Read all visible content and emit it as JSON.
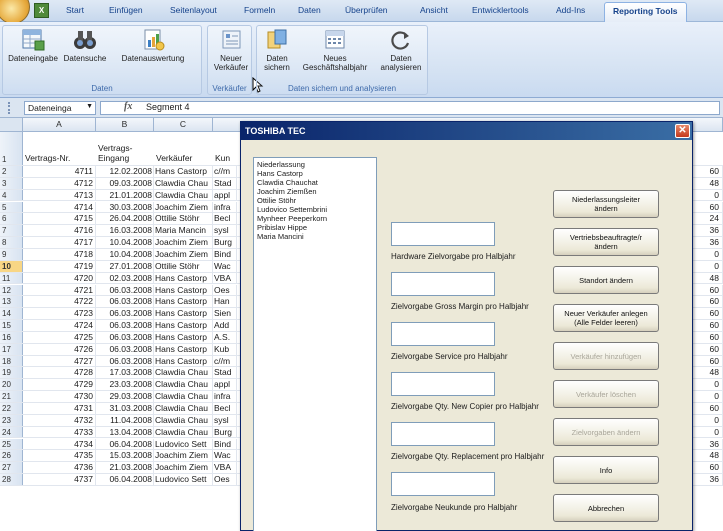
{
  "ribbon": {
    "tabs": [
      "Start",
      "Einfügen",
      "Seitenlayout",
      "Formeln",
      "Daten",
      "Überprüfen",
      "Ansicht",
      "Entwicklertools",
      "Add-Ins",
      "Reporting Tools"
    ],
    "active_tab": "Reporting Tools",
    "groups": {
      "daten": {
        "label": "Daten",
        "buttons": [
          "Dateneingabe",
          "Datensuche",
          "Datenauswertung"
        ]
      },
      "verkaeufer": {
        "label": "Verkäufer",
        "button_line1": "Neuer",
        "button_line2": "Verkäufer"
      },
      "sichern": {
        "label": "Daten sichern und analysieren",
        "btn1_line1": "Daten",
        "btn1_line2": "sichern",
        "btn2_line1": "Neues",
        "btn2_line2": "Geschäftshalbjahr",
        "btn3_line1": "Daten",
        "btn3_line2": "analysieren"
      }
    }
  },
  "formula_bar": {
    "name_box": "Dateneinga",
    "fx": "fx",
    "value": "Segment 4"
  },
  "sheet": {
    "columns": [
      "A",
      "B",
      "C"
    ],
    "header_row": {
      "num": "1",
      "a": "Vertrags-Nr.",
      "b_line1": "Vertrags-",
      "b_line2": "Eingang",
      "c": "Verkäufer",
      "d": "Kun"
    },
    "rows": [
      {
        "n": "2",
        "a": "4711",
        "b": "12.02.2008",
        "c": "Hans Castorp",
        "d": "c//m",
        "r": "60"
      },
      {
        "n": "3",
        "a": "4712",
        "b": "09.03.2008",
        "c": "Clawdia Chau",
        "d": "Stad",
        "r": "48"
      },
      {
        "n": "4",
        "a": "4713",
        "b": "21.01.2008",
        "c": "Clawdia Chau",
        "d": "appl",
        "r": "0"
      },
      {
        "n": "5",
        "a": "4714",
        "b": "30.03.2008",
        "c": "Joachim Ziem",
        "d": "infra",
        "r": "60"
      },
      {
        "n": "6",
        "a": "4715",
        "b": "26.04.2008",
        "c": "Ottilie Stöhr",
        "d": "Becl",
        "r": "24"
      },
      {
        "n": "7",
        "a": "4716",
        "b": "16.03.2008",
        "c": "Maria Mancin",
        "d": "sysl",
        "r": "36"
      },
      {
        "n": "8",
        "a": "4717",
        "b": "10.04.2008",
        "c": "Joachim Ziem",
        "d": "Burg",
        "r": "36"
      },
      {
        "n": "9",
        "a": "4718",
        "b": "10.04.2008",
        "c": "Joachim Ziem",
        "d": "Bind",
        "r": "0"
      },
      {
        "n": "10",
        "a": "4719",
        "b": "27.01.2008",
        "c": "Ottilie Stöhr",
        "d": "Wac",
        "r": "0"
      },
      {
        "n": "11",
        "a": "4720",
        "b": "02.03.2008",
        "c": "Hans Castorp",
        "d": "VBA",
        "r": "48"
      },
      {
        "n": "12",
        "a": "4721",
        "b": "06.03.2008",
        "c": "Hans Castorp",
        "d": "Oes",
        "r": "60"
      },
      {
        "n": "13",
        "a": "4722",
        "b": "06.03.2008",
        "c": "Hans Castorp",
        "d": "Han",
        "r": "60"
      },
      {
        "n": "14",
        "a": "4723",
        "b": "06.03.2008",
        "c": "Hans Castorp",
        "d": "Sien",
        "r": "60"
      },
      {
        "n": "15",
        "a": "4724",
        "b": "06.03.2008",
        "c": "Hans Castorp",
        "d": "Add",
        "r": "60"
      },
      {
        "n": "16",
        "a": "4725",
        "b": "06.03.2008",
        "c": "Hans Castorp",
        "d": "A.S.",
        "r": "60"
      },
      {
        "n": "17",
        "a": "4726",
        "b": "06.03.2008",
        "c": "Hans Castorp",
        "d": "Kub",
        "r": "60"
      },
      {
        "n": "18",
        "a": "4727",
        "b": "06.03.2008",
        "c": "Hans Castorp",
        "d": "c//m",
        "r": "60"
      },
      {
        "n": "19",
        "a": "4728",
        "b": "17.03.2008",
        "c": "Clawdia Chau",
        "d": "Stad",
        "r": "48"
      },
      {
        "n": "20",
        "a": "4729",
        "b": "23.03.2008",
        "c": "Clawdia Chau",
        "d": "appl",
        "r": "0"
      },
      {
        "n": "21",
        "a": "4730",
        "b": "29.03.2008",
        "c": "Clawdia Chau",
        "d": "infra",
        "r": "0"
      },
      {
        "n": "22",
        "a": "4731",
        "b": "31.03.2008",
        "c": "Clawdia Chau",
        "d": "Becl",
        "r": "60"
      },
      {
        "n": "23",
        "a": "4732",
        "b": "11.04.2008",
        "c": "Clawdia Chau",
        "d": "sysl",
        "r": "0"
      },
      {
        "n": "24",
        "a": "4733",
        "b": "13.04.2008",
        "c": "Clawdia Chau",
        "d": "Burg",
        "r": "0"
      },
      {
        "n": "25",
        "a": "4734",
        "b": "06.04.2008",
        "c": "Ludovico Sett",
        "d": "Bind",
        "r": "36"
      },
      {
        "n": "26",
        "a": "4735",
        "b": "15.03.2008",
        "c": "Joachim Ziem",
        "d": "Wac",
        "r": "48"
      },
      {
        "n": "27",
        "a": "4736",
        "b": "21.03.2008",
        "c": "Joachim Ziem",
        "d": "VBA",
        "r": "60"
      },
      {
        "n": "28",
        "a": "4737",
        "b": "06.04.2008",
        "c": "Ludovico Sett",
        "d": "Oes",
        "r": "36"
      }
    ]
  },
  "dialog": {
    "title": "TOSHIBA TEC",
    "close": "✕",
    "list_items": [
      "Niederlassung",
      "Hans Castorp",
      "Clawdia Chauchat",
      "Joachim Ziemßen",
      "Ottilie Stöhr",
      "Ludovico Settembrini",
      "Mynheer Peeperkorn",
      "Pribislav Hippe",
      "Maria Mancini"
    ],
    "fields": [
      {
        "label": "Hardware Zielvorgabe pro Halbjahr"
      },
      {
        "label": "Zielvorgabe Gross Margin pro Halbjahr"
      },
      {
        "label": "Zielvorgabe Service pro Halbjahr"
      },
      {
        "label": "Zielvorgabe Qty. New Copier pro Halbjahr"
      },
      {
        "label": "Zielvorgabe Qty. Replacement pro Halbjahr"
      },
      {
        "label": "Zielvorgabe Neukunde pro Halbjahr"
      }
    ],
    "buttons": {
      "niederlassungsleiter_line1": "Niederlassungsleiter",
      "niederlassungsleiter_line2": "ändern",
      "vertriebs_line1": "Vertriebsbeauftragte/r",
      "vertriebs_line2": "ändern",
      "standort": "Standort ändern",
      "neuer_line1": "Neuer Verkäufer anlegen",
      "neuer_line2": "(Alle Felder leeren)",
      "hinzufuegen": "Verkäufer hinzufügen",
      "loeschen": "Verkäufer löschen",
      "zielvorgaben": "Zielvorgaben ändern",
      "info": "Info",
      "abbrechen": "Abbrechen"
    }
  }
}
